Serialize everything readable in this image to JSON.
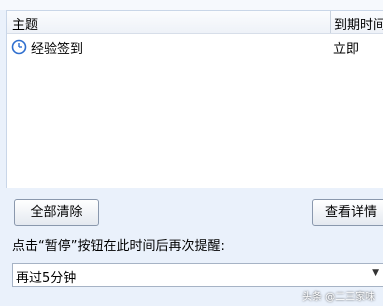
{
  "list": {
    "columns": {
      "subject": "主题",
      "due": "到期时间"
    },
    "rows": [
      {
        "subject": "经验签到",
        "due": "立即",
        "icon": "clock-icon"
      }
    ]
  },
  "buttons": {
    "clear_all": "全部清除",
    "view_details": "查看详情"
  },
  "prompt": "点击“暂停”按钮在此时间后再次提醒:",
  "snooze": {
    "selected": "再过5分钟"
  },
  "watermark": "头条 @二三家味",
  "colors": {
    "background": "#eaf1fb",
    "icon": "#2f6fcf"
  }
}
